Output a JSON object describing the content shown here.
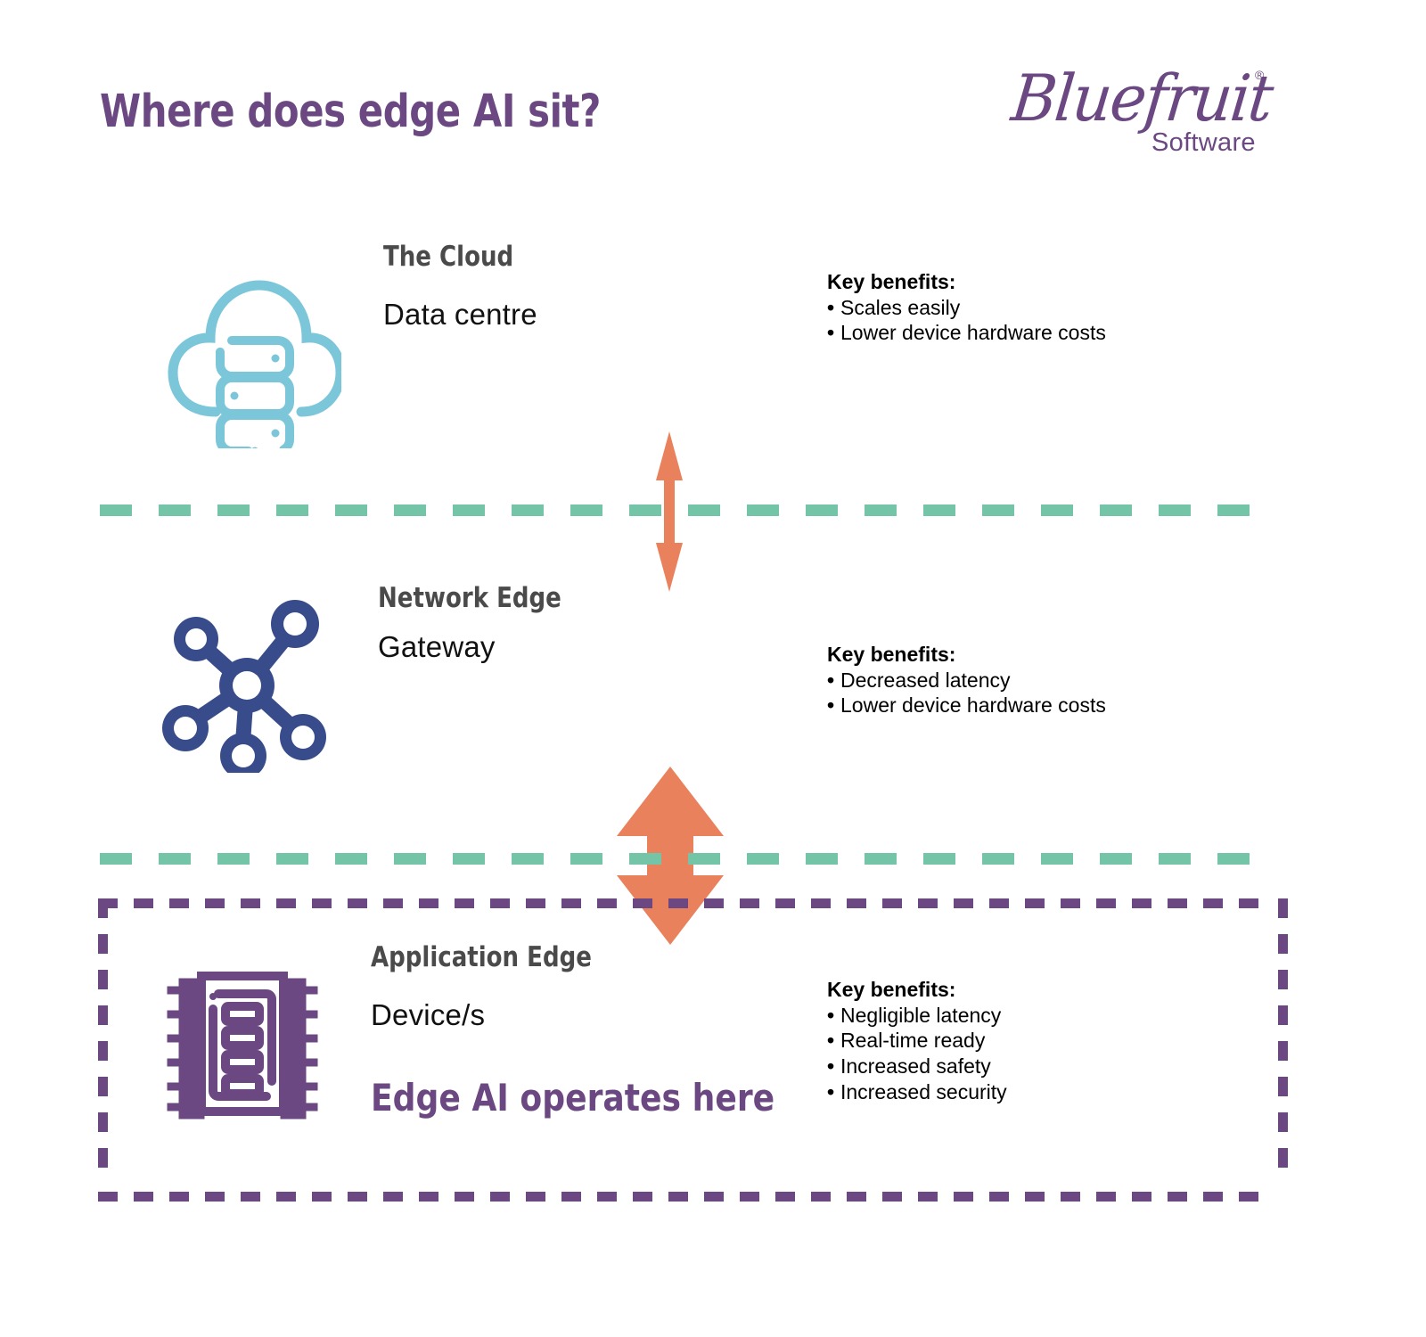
{
  "header": {
    "title": "Where does edge AI sit?",
    "logo": {
      "script": "Bluefruit",
      "registered": "®",
      "sub": "Software"
    }
  },
  "colors": {
    "purple": "#6b4882",
    "heading_gray": "#4a4a4a",
    "cloud_blue": "#7cc6da",
    "network_navy": "#384c8c",
    "chip_purple": "#6b4882",
    "dash_green": "#74c5a8",
    "arrow_orange": "#e9825c",
    "text_black": "#000000"
  },
  "tiers": [
    {
      "id": "cloud",
      "icon": "cloud-server-icon",
      "heading": "The Cloud",
      "sub": "Data centre",
      "benefits": {
        "title": "Key benefits:",
        "items": [
          "Scales easily",
          "Lower device hardware costs"
        ]
      }
    },
    {
      "id": "network-edge",
      "icon": "network-hub-icon",
      "heading": "Network Edge",
      "sub": "Gateway",
      "benefits": {
        "title": "Key benefits:",
        "items": [
          "Decreased latency",
          "Lower device hardware costs"
        ]
      }
    },
    {
      "id": "application-edge",
      "icon": "microchip-icon",
      "heading": "Application Edge",
      "sub": "Device/s",
      "highlight": "Edge AI operates here",
      "benefits": {
        "title": "Key benefits:",
        "items": [
          "Negligible latency",
          "Real-time ready",
          "Increased safety",
          "Increased security"
        ]
      }
    }
  ],
  "arrows": [
    {
      "id": "cloud-network-arrow",
      "icon": "double-headed-vertical-arrow"
    },
    {
      "id": "network-device-arrow",
      "icon": "double-headed-vertical-arrow-large"
    }
  ],
  "separators": [
    {
      "id": "cloud-network-divider",
      "icon": "horizontal-dashed-line"
    },
    {
      "id": "network-device-divider",
      "icon": "horizontal-dashed-line"
    }
  ],
  "highlight_box": {
    "id": "edge-ai-zone-box",
    "icon": "dashed-rectangle"
  }
}
